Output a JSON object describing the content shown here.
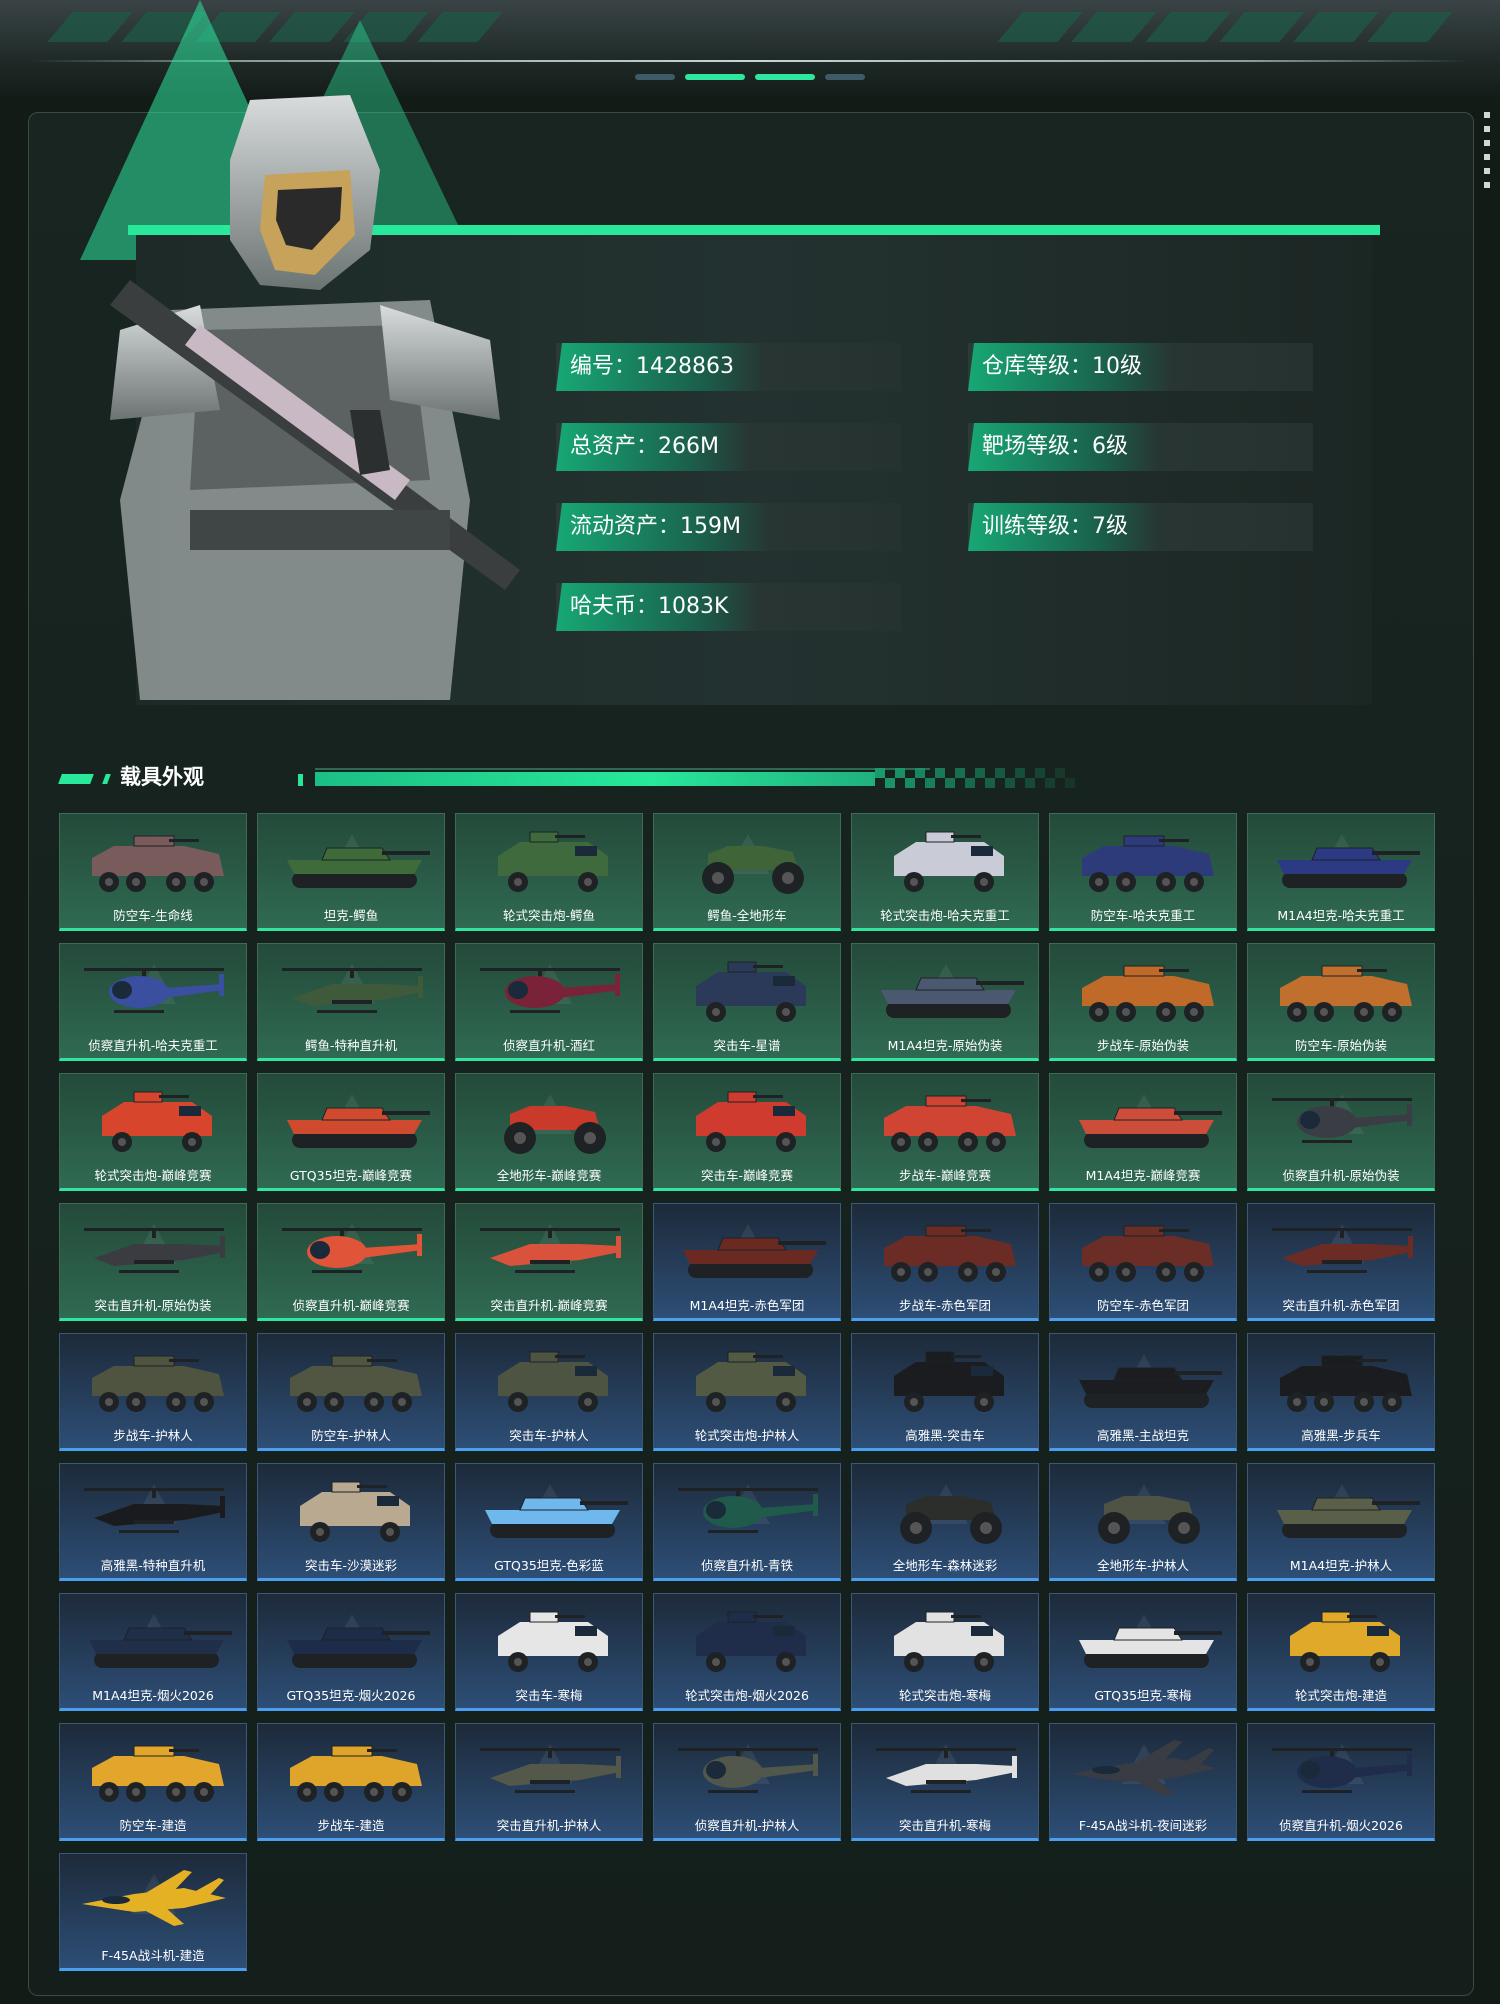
{
  "stats": [
    {
      "label": "编号：1428863"
    },
    {
      "label": "仓库等级：10级"
    },
    {
      "label": "总资产：266M"
    },
    {
      "label": "靶场等级：6级"
    },
    {
      "label": "流动资产：159M"
    },
    {
      "label": "训练等级：7级"
    },
    {
      "label": "哈夫币：1083K"
    }
  ],
  "section_title": "载具外观",
  "vehicles": [
    {
      "name": "防空车-生命线",
      "kind": "apc",
      "tier": "green",
      "color": "#7a5b5b"
    },
    {
      "name": "坦克-鳄鱼",
      "kind": "tank",
      "tier": "green",
      "color": "#3f6b3a"
    },
    {
      "name": "轮式突击炮-鳄鱼",
      "kind": "truck",
      "tier": "green",
      "color": "#3e6a3d"
    },
    {
      "name": "鳄鱼-全地形车",
      "kind": "atv",
      "tier": "green",
      "color": "#3e6438"
    },
    {
      "name": "轮式突击炮-哈夫克重工",
      "kind": "truck",
      "tier": "green",
      "color": "#c9ccd6"
    },
    {
      "name": "防空车-哈夫克重工",
      "kind": "apc",
      "tier": "green",
      "color": "#2e3b7a"
    },
    {
      "name": "M1A4坦克-哈夫克重工",
      "kind": "tank",
      "tier": "green",
      "color": "#2b3a82"
    },
    {
      "name": "侦察直升机-哈夫克重工",
      "kind": "heli",
      "tier": "green",
      "color": "#3b4fa0"
    },
    {
      "name": "鳄鱼-特种直升机",
      "kind": "attackheli",
      "tier": "green",
      "color": "#3e5a3a"
    },
    {
      "name": "侦察直升机-酒红",
      "kind": "heli",
      "tier": "green",
      "color": "#7a2238"
    },
    {
      "name": "突击车-星谱",
      "kind": "truck",
      "tier": "green",
      "color": "#2c3a5a"
    },
    {
      "name": "M1A4坦克-原始伪装",
      "kind": "tank",
      "tier": "green",
      "color": "#4a5870"
    },
    {
      "name": "步战车-原始伪装",
      "kind": "apc",
      "tier": "green",
      "color": "#c06a2a"
    },
    {
      "name": "防空车-原始伪装",
      "kind": "apc",
      "tier": "green",
      "color": "#c0702c"
    },
    {
      "name": "轮式突击炮-巅峰竞赛",
      "kind": "truck",
      "tier": "green",
      "color": "#d6452c"
    },
    {
      "name": "GTQ35坦克-巅峰竞赛",
      "kind": "tank",
      "tier": "green",
      "color": "#d04a30"
    },
    {
      "name": "全地形车-巅峰竞赛",
      "kind": "atv",
      "tier": "green",
      "color": "#c93a2a"
    },
    {
      "name": "突击车-巅峰竞赛",
      "kind": "truck",
      "tier": "green",
      "color": "#cf3b2e"
    },
    {
      "name": "步战车-巅峰竞赛",
      "kind": "apc",
      "tier": "green",
      "color": "#d04434"
    },
    {
      "name": "M1A4坦克-巅峰竞赛",
      "kind": "tank",
      "tier": "green",
      "color": "#cc4d3a"
    },
    {
      "name": "侦察直升机-原始伪装",
      "kind": "heli",
      "tier": "green",
      "color": "#3b3d44"
    },
    {
      "name": "突击直升机-原始伪装",
      "kind": "attackheli",
      "tier": "green",
      "color": "#3a3c42"
    },
    {
      "name": "侦察直升机-巅峰竞赛",
      "kind": "heli",
      "tier": "green",
      "color": "#e0553a"
    },
    {
      "name": "突击直升机-巅峰竞赛",
      "kind": "attackheli",
      "tier": "green",
      "color": "#d9523c"
    },
    {
      "name": "M1A4坦克-赤色军团",
      "kind": "tank",
      "tier": "blue",
      "color": "#6a2a22"
    },
    {
      "name": "步战车-赤色军团",
      "kind": "apc",
      "tier": "blue",
      "color": "#6a2c24"
    },
    {
      "name": "防空车-赤色军团",
      "kind": "apc",
      "tier": "blue",
      "color": "#6b2e26"
    },
    {
      "name": "突击直升机-赤色军团",
      "kind": "attackheli",
      "tier": "blue",
      "color": "#6a2c24"
    },
    {
      "name": "步战车-护林人",
      "kind": "apc",
      "tier": "blue",
      "color": "#4e5440"
    },
    {
      "name": "防空车-护林人",
      "kind": "apc",
      "tier": "blue",
      "color": "#515642"
    },
    {
      "name": "突击车-护林人",
      "kind": "truck",
      "tier": "blue",
      "color": "#4e5442"
    },
    {
      "name": "轮式突击炮-护林人",
      "kind": "truck",
      "tier": "blue",
      "color": "#525a44"
    },
    {
      "name": "高雅黑-突击车",
      "kind": "truck",
      "tier": "blue",
      "color": "#1a1c20"
    },
    {
      "name": "高雅黑-主战坦克",
      "kind": "tank",
      "tier": "blue",
      "color": "#1b1d21"
    },
    {
      "name": "高雅黑-步兵车",
      "kind": "apc",
      "tier": "blue",
      "color": "#1b1c20"
    },
    {
      "name": "高雅黑-特种直升机",
      "kind": "attackheli",
      "tier": "blue",
      "color": "#1a1b1f"
    },
    {
      "name": "突击车-沙漠迷彩",
      "kind": "truck",
      "tier": "blue",
      "color": "#b8a990"
    },
    {
      "name": "GTQ35坦克-色彩蓝",
      "kind": "tank",
      "tier": "blue",
      "color": "#6fb8ee"
    },
    {
      "name": "侦察直升机-青铁",
      "kind": "heli",
      "tier": "blue",
      "color": "#1f5a4a"
    },
    {
      "name": "全地形车-森林迷彩",
      "kind": "atv",
      "tier": "blue",
      "color": "#2b2e2a"
    },
    {
      "name": "全地形车-护林人",
      "kind": "atv",
      "tier": "blue",
      "color": "#4f5344"
    },
    {
      "name": "M1A4坦克-护林人",
      "kind": "tank",
      "tier": "blue",
      "color": "#5a5f4a"
    },
    {
      "name": "M1A4坦克-烟火2026",
      "kind": "tank",
      "tier": "blue",
      "color": "#1f2f4a"
    },
    {
      "name": "GTQ35坦克-烟火2026",
      "kind": "tank",
      "tier": "blue",
      "color": "#1d2c48"
    },
    {
      "name": "突击车-寒梅",
      "kind": "truck",
      "tier": "blue",
      "color": "#e6e6e6"
    },
    {
      "name": "轮式突击炮-烟火2026",
      "kind": "truck",
      "tier": "blue",
      "color": "#1f2c4a"
    },
    {
      "name": "轮式突击炮-寒梅",
      "kind": "truck",
      "tier": "blue",
      "color": "#e2e2e2"
    },
    {
      "name": "GTQ35坦克-寒梅",
      "kind": "tank",
      "tier": "blue",
      "color": "#e4e4e4"
    },
    {
      "name": "轮式突击炮-建造",
      "kind": "truck",
      "tier": "blue",
      "color": "#e0a92a"
    },
    {
      "name": "防空车-建造",
      "kind": "apc",
      "tier": "blue",
      "color": "#e2a62c"
    },
    {
      "name": "步战车-建造",
      "kind": "apc",
      "tier": "blue",
      "color": "#dfa42a"
    },
    {
      "name": "突击直升机-护林人",
      "kind": "attackheli",
      "tier": "blue",
      "color": "#53584a"
    },
    {
      "name": "侦察直升机-护林人",
      "kind": "heli",
      "tier": "blue",
      "color": "#51574a"
    },
    {
      "name": "突击直升机-寒梅",
      "kind": "attackheli",
      "tier": "blue",
      "color": "#e0e0e0"
    },
    {
      "name": "F-45A战斗机-夜间迷彩",
      "kind": "jet",
      "tier": "blue",
      "color": "#3a3c44"
    },
    {
      "name": "侦察直升机-烟火2026",
      "kind": "heli",
      "tier": "blue",
      "color": "#1f2c4a"
    },
    {
      "name": "F-45A战斗机-建造",
      "kind": "jet",
      "tier": "blue",
      "color": "#e4b024"
    }
  ],
  "colors": {
    "accent": "#27e89b",
    "tile_green_border": "#2ee6a0",
    "tile_blue_border": "#4a9ff0"
  }
}
